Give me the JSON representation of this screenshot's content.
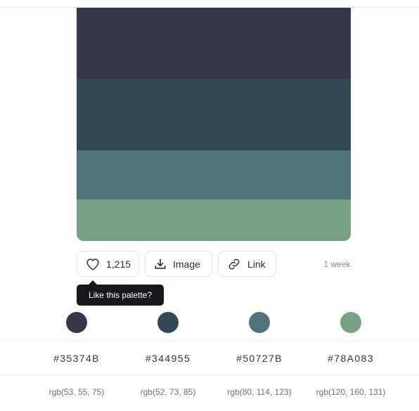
{
  "palette": {
    "colors": [
      {
        "hex": "#35374B",
        "rgb": "rgb(53, 55, 75)"
      },
      {
        "hex": "#344955",
        "rgb": "rgb(52, 73, 85)"
      },
      {
        "hex": "#50727B",
        "rgb": "rgb(80, 114, 123)"
      },
      {
        "hex": "#78A083",
        "rgb": "rgb(120, 160, 131)"
      }
    ]
  },
  "actions": {
    "like_count": "1,215",
    "image_label": "Image",
    "link_label": "Link",
    "icons": {
      "like": "heart-icon",
      "image": "download-icon",
      "link": "link-icon"
    }
  },
  "meta": {
    "time_ago": "1 week"
  },
  "tooltip": {
    "text": "Like this palette?"
  }
}
